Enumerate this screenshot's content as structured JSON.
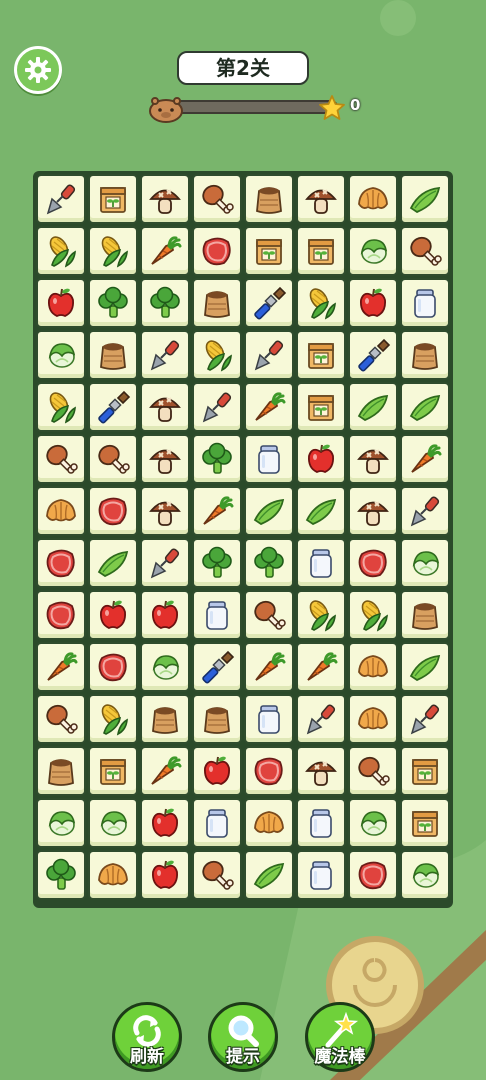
{
  "header": {
    "level_title": "第2关",
    "score": "0",
    "progress_fraction": 0
  },
  "colors": {
    "background": "#79b56c",
    "tile_face": "#f7f9d8",
    "button_green": "#6fd13a",
    "star_yellow": "#ffd23a"
  },
  "icons": {
    "settings": "gear-icon",
    "avatar": "capybara-icon",
    "star": "star-icon",
    "refresh": "refresh-icon",
    "hint": "magnifier-icon",
    "magic": "magic-wand-icon"
  },
  "board": {
    "columns": 8,
    "rows": [
      [
        "trowel",
        "sprout-box",
        "mushroom",
        "drumstick",
        "soil-sack",
        "mushroom",
        "croissant",
        "pea-pod"
      ],
      [
        "corn",
        "corn",
        "carrot",
        "steak",
        "sprout-box",
        "sprout-box",
        "cabbage",
        "drumstick"
      ],
      [
        "apple",
        "broccoli",
        "broccoli",
        "soil-sack",
        "paintbrush",
        "corn",
        "apple",
        "jar"
      ],
      [
        "cabbage",
        "soil-sack",
        "trowel",
        "corn",
        "trowel",
        "sprout-box",
        "paintbrush",
        "soil-sack"
      ],
      [
        "corn",
        "paintbrush",
        "mushroom",
        "trowel",
        "carrot",
        "sprout-box",
        "pea-pod",
        "pea-pod"
      ],
      [
        "drumstick",
        "drumstick",
        "mushroom",
        "broccoli",
        "jar",
        "apple",
        "mushroom",
        "carrot"
      ],
      [
        "croissant",
        "steak",
        "mushroom",
        "carrot",
        "pea-pod",
        "pea-pod",
        "mushroom",
        "trowel"
      ],
      [
        "steak",
        "pea-pod",
        "trowel",
        "broccoli",
        "broccoli",
        "jar",
        "steak",
        "cabbage"
      ],
      [
        "steak",
        "apple",
        "apple",
        "jar",
        "drumstick",
        "corn",
        "corn",
        "soil-sack"
      ],
      [
        "carrot",
        "steak",
        "cabbage",
        "paintbrush",
        "carrot",
        "carrot",
        "croissant",
        "pea-pod"
      ],
      [
        "drumstick",
        "corn",
        "soil-sack",
        "soil-sack",
        "jar",
        "trowel",
        "croissant",
        "trowel"
      ],
      [
        "soil-sack",
        "sprout-box",
        "carrot",
        "apple",
        "steak",
        "mushroom",
        "drumstick",
        "sprout-box"
      ],
      [
        "cabbage",
        "cabbage",
        "apple",
        "jar",
        "croissant",
        "jar",
        "cabbage",
        "sprout-box"
      ],
      [
        "broccoli",
        "croissant",
        "apple",
        "drumstick",
        "pea-pod",
        "jar",
        "steak",
        "cabbage"
      ]
    ]
  },
  "tools": {
    "refresh_label": "刷新",
    "hint_label": "提示",
    "magic_label": "魔法棒"
  }
}
